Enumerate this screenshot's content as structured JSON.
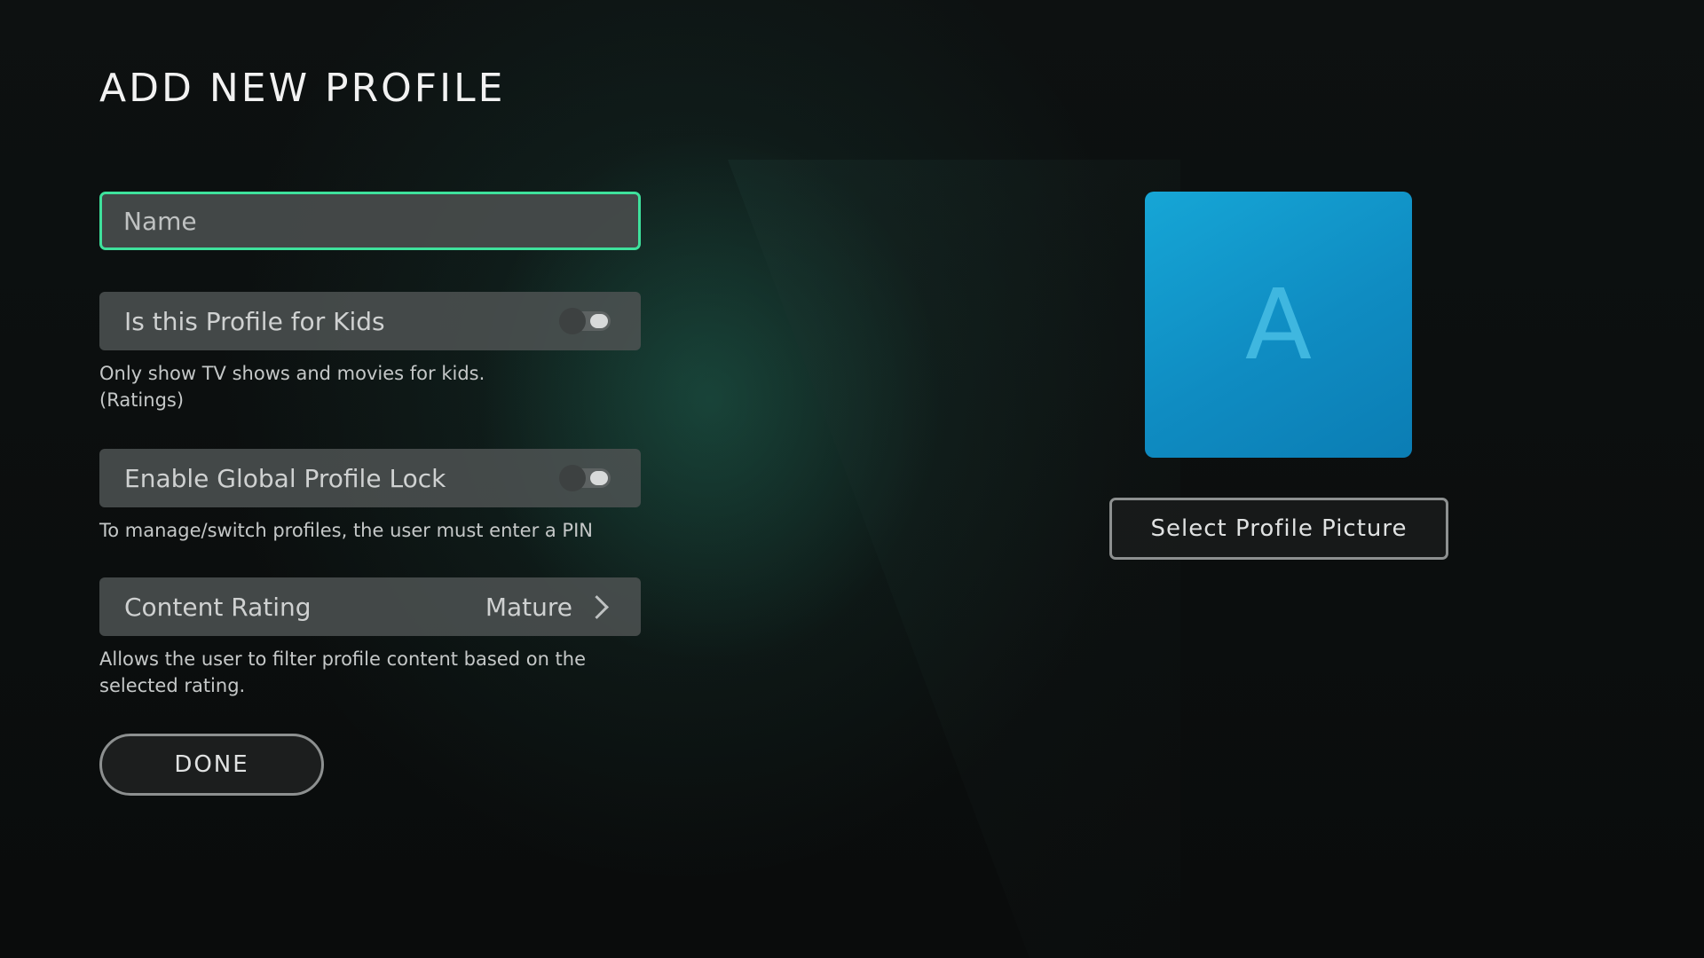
{
  "page": {
    "title": "ADD NEW PROFILE"
  },
  "form": {
    "name_field": {
      "placeholder": "Name",
      "value": ""
    },
    "kids_toggle": {
      "label": "Is this Profile for Kids",
      "state": "off",
      "description_line1": "Only show TV shows and movies for kids.",
      "description_line2": "(Ratings)"
    },
    "global_lock_toggle": {
      "label": "Enable Global Profile Lock",
      "state": "off",
      "description": "To manage/switch profiles, the user must enter a PIN"
    },
    "content_rating": {
      "label": "Content Rating",
      "value": "Mature",
      "description": "Allows the user to filter profile content based on the selected rating."
    },
    "done_label": "DONE"
  },
  "profile_picture": {
    "avatar_letter": "A",
    "select_label": "Select Profile Picture"
  },
  "colors": {
    "focus_accent": "#3ee19c",
    "avatar_blue": "#1296cc",
    "background": "#0b0d0d"
  },
  "icons": {
    "rating_chevron": "chevron-right-icon"
  }
}
